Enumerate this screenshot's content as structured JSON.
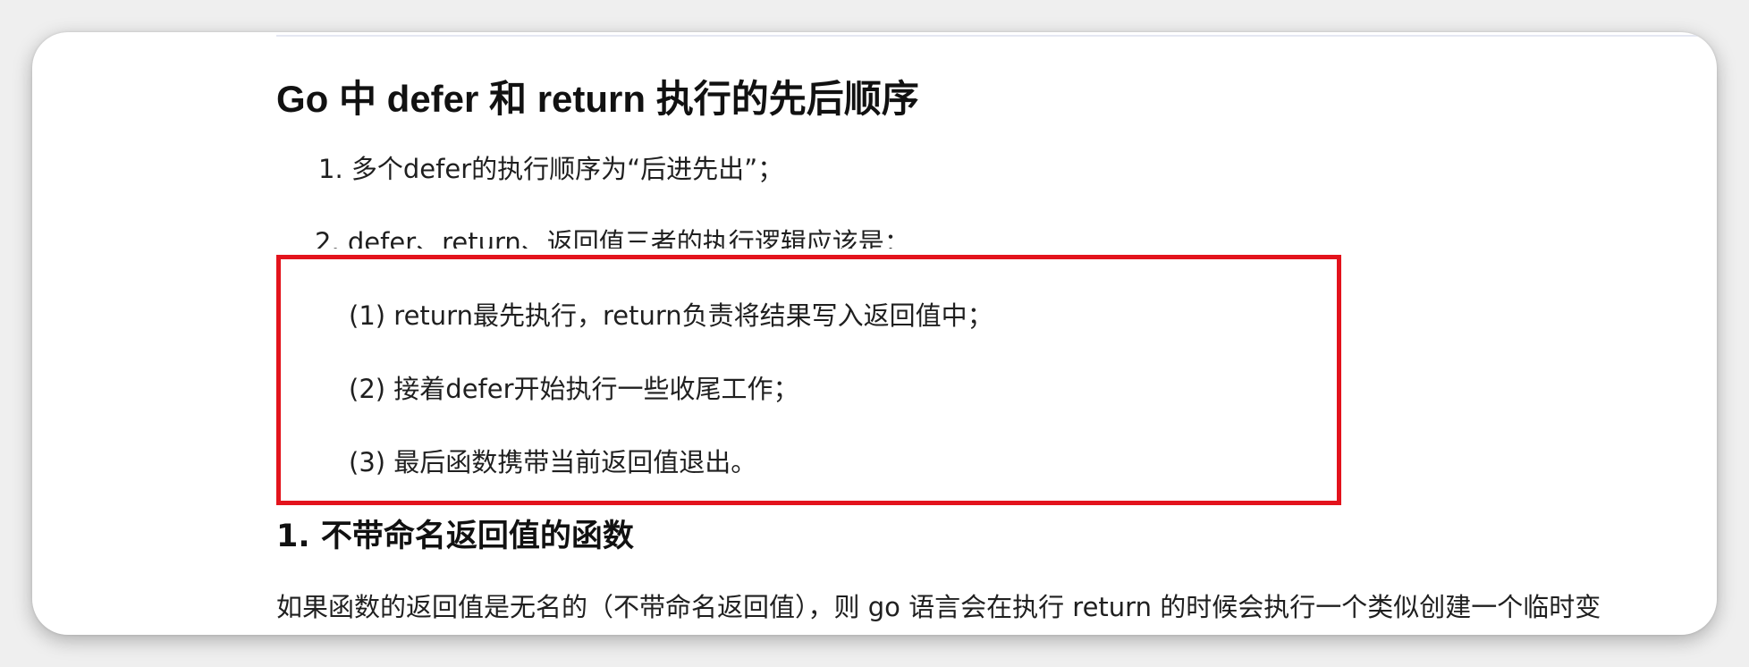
{
  "document": {
    "title": "Go 中 defer 和 return 执行的先后顺序",
    "list": [
      "1. 多个defer的执行顺序为“后进先出”；",
      "2. defer、return、返回值三者的执行逻辑应该是："
    ],
    "steps": [
      "(1) return最先执行，return负责将结果写入返回值中；",
      "(2) 接着defer开始执行一些收尾工作；",
      "(3) 最后函数携带当前返回值退出。"
    ],
    "section_heading": "1. 不带命名返回值的函数",
    "paragraph": "如果函数的返回值是无名的（不带命名返回值），则 go 语言会在执行 return 的时候会执行一个类似创建一个临时变"
  },
  "colors": {
    "highlight_border": "#e3131c",
    "text": "#1f1f1f",
    "page_background": "#ffffff"
  }
}
